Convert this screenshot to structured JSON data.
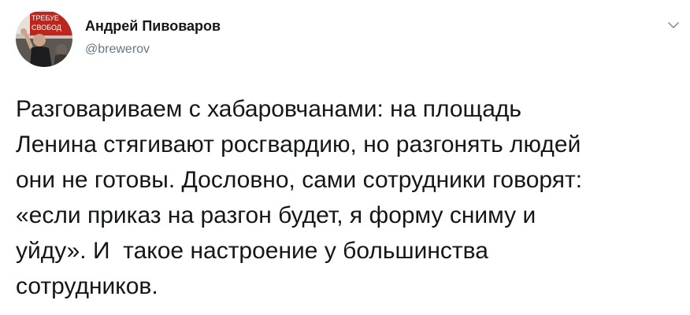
{
  "author": {
    "name": "Андрей Пивоваров",
    "handle": "@brewerov",
    "avatar_sign_text": "ТРЕБУЕ СВОБОД"
  },
  "menu_icon": "chevron-down-icon",
  "tweet": {
    "lines": [
      "Разговариваем с хабаровчанами: на площадь",
      "Ленина стягивают росгвардию, но разгонять людей",
      "они не готовы. Дословно, сами сотрудники говорят:",
      "«если приказ на разгон будет, я форму сниму и",
      "уйду». И  такое настроение у большинства",
      "сотрудников."
    ]
  },
  "colors": {
    "text": "#14171a",
    "secondary": "#657786",
    "icon": "#8899a6",
    "background": "#ffffff"
  }
}
